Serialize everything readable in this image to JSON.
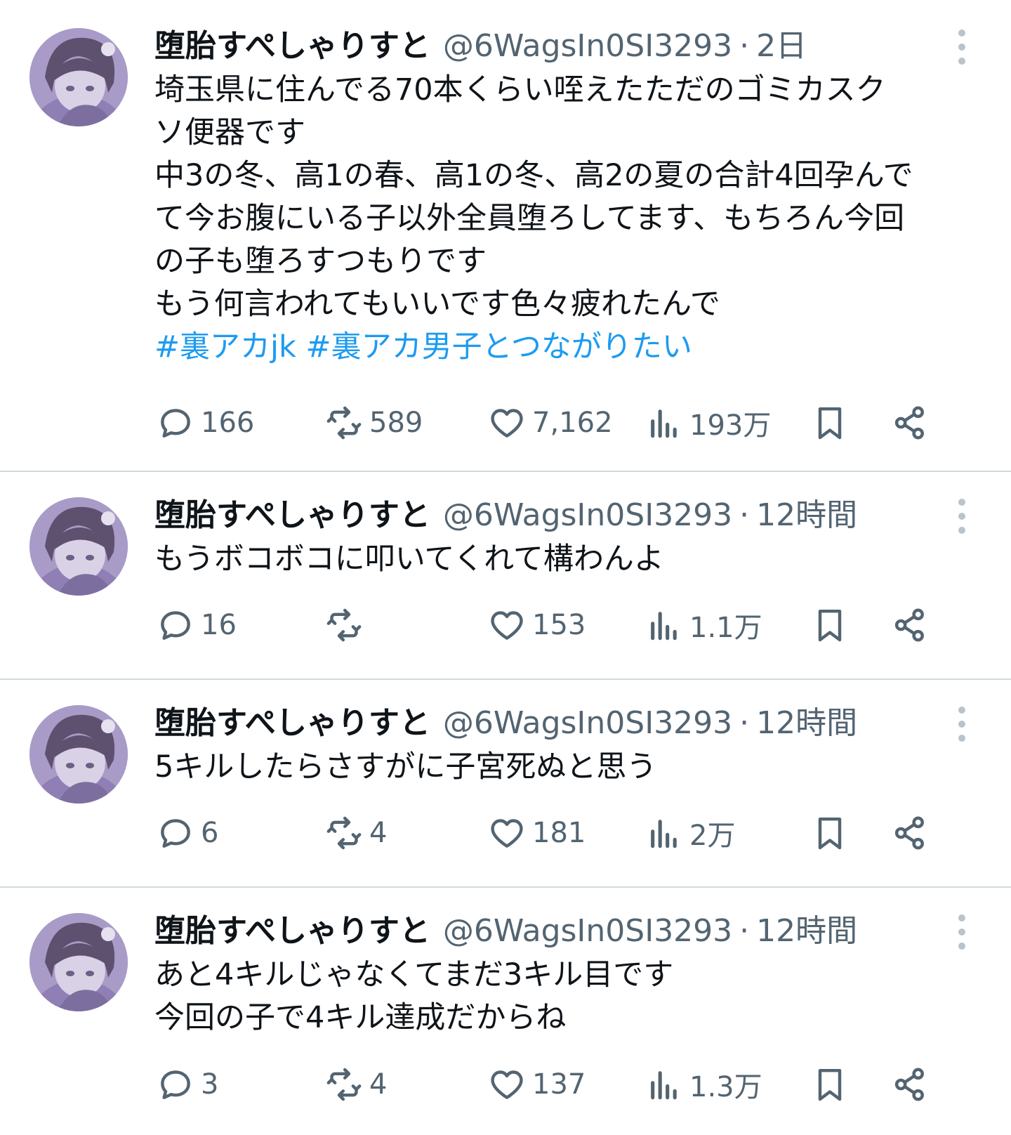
{
  "tweets": [
    {
      "author_name": "堕胎すぺしゃりすと",
      "handle": "@6WagsIn0SI3293",
      "separator": "·",
      "time": "2日",
      "lines": [
        "埼玉県に住んでる70本くらい咥えたただのゴミカスク",
        "ソ便器です",
        "中3の冬、高1の春、高1の冬、高2の夏の合計4回孕んで",
        "て今お腹にいる子以外全員堕ろしてます、もちろん今回",
        "の子も堕ろすつもりです",
        "もう何言われてもいいです色々疲れたんで"
      ],
      "hashtags": "#裏アカjk #裏アカ男子とつながりたい",
      "replies": "166",
      "retweets": "589",
      "likes": "7,162",
      "views": "193万"
    },
    {
      "author_name": "堕胎すぺしゃりすと",
      "handle": "@6WagsIn0SI3293",
      "separator": "·",
      "time": "12時間",
      "lines": [
        "もうボコボコに叩いてくれて構わんよ"
      ],
      "replies": "16",
      "retweets": "",
      "likes": "153",
      "views": "1.1万"
    },
    {
      "author_name": "堕胎すぺしゃりすと",
      "handle": "@6WagsIn0SI3293",
      "separator": "·",
      "time": "12時間",
      "lines": [
        "5キルしたらさすがに子宮死ぬと思う"
      ],
      "replies": "6",
      "retweets": "4",
      "likes": "181",
      "views": "2万"
    },
    {
      "author_name": "堕胎すぺしゃりすと",
      "handle": "@6WagsIn0SI3293",
      "separator": "·",
      "time": "12時間",
      "lines": [
        "あと4キルじゃなくてまだ3キル目です",
        "今回の子で4キル達成だからね"
      ],
      "replies": "3",
      "retweets": "4",
      "likes": "137",
      "views": "1.3万"
    }
  ],
  "icons": {
    "reply": "reply-bubble-icon",
    "retweet": "retweet-arrows-icon",
    "like": "heart-icon",
    "views": "bar-chart-icon",
    "bookmark": "bookmark-icon",
    "share": "share-icon",
    "more": "more-vertical-icon"
  },
  "colors": {
    "text": "#0f1419",
    "secondary": "#536471",
    "hashtag": "#1d9bf0",
    "divider": "#cfd9de",
    "avatar": "#a99bc7"
  }
}
